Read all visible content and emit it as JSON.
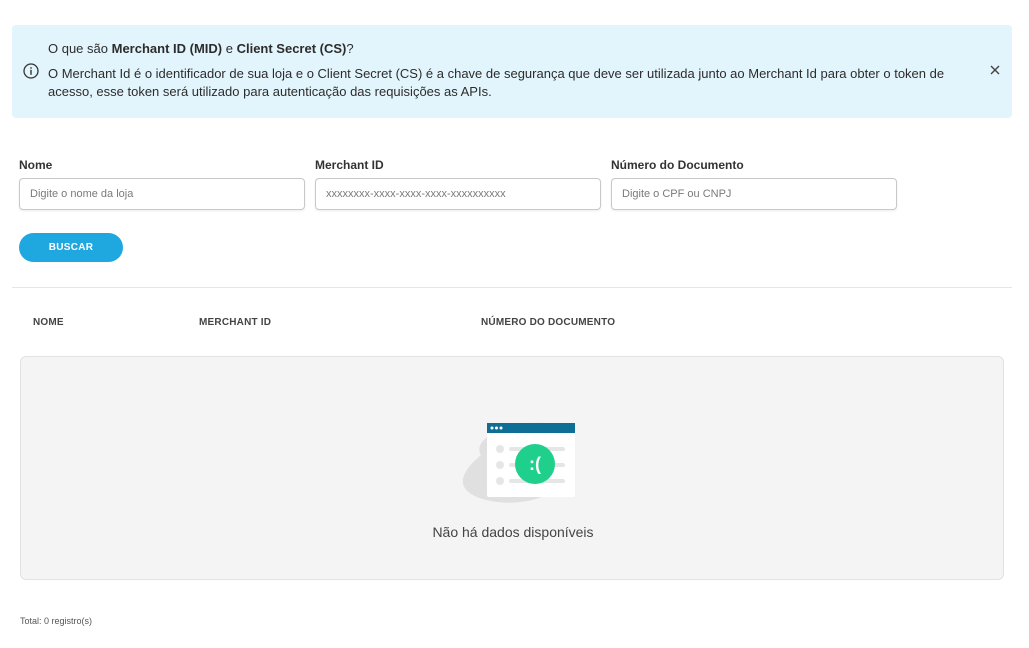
{
  "info_banner": {
    "title_prefix": "O que são ",
    "title_mid": "Merchant ID (MID)",
    "title_connector": " e ",
    "title_cs": "Client Secret (CS)",
    "title_suffix": "?",
    "text": "O Merchant Id é o identificador de sua loja e o Client Secret (CS) é a chave de segurança que deve ser utilizada junto ao Merchant Id para obter o token de acesso, esse token será utilizado para autenticação das requisições as APIs.",
    "icon": "info-icon",
    "close_icon": "close-icon"
  },
  "form": {
    "name": {
      "label": "Nome",
      "placeholder": "Digite o nome da loja",
      "value": ""
    },
    "merchant_id": {
      "label": "Merchant ID",
      "placeholder": "xxxxxxxx-xxxx-xxxx-xxxx-xxxxxxxxxx",
      "value": ""
    },
    "document": {
      "label": "Número do Documento",
      "placeholder": "Digite o CPF ou CNPJ",
      "value": ""
    },
    "search_label": "BUSCAR"
  },
  "table": {
    "columns": [
      "NOME",
      "MERCHANT ID",
      "NÚMERO DO DOCUMENTO"
    ],
    "rows": [],
    "empty_message": "Não há dados disponíveis",
    "empty_face": ":("
  },
  "footer": {
    "total": "Total: 0 registro(s)"
  },
  "colors": {
    "banner_bg": "#e3f5fc",
    "accent": "#1fa7e0",
    "illustration_bar": "#0f6e95",
    "face_green": "#1fd08c"
  }
}
